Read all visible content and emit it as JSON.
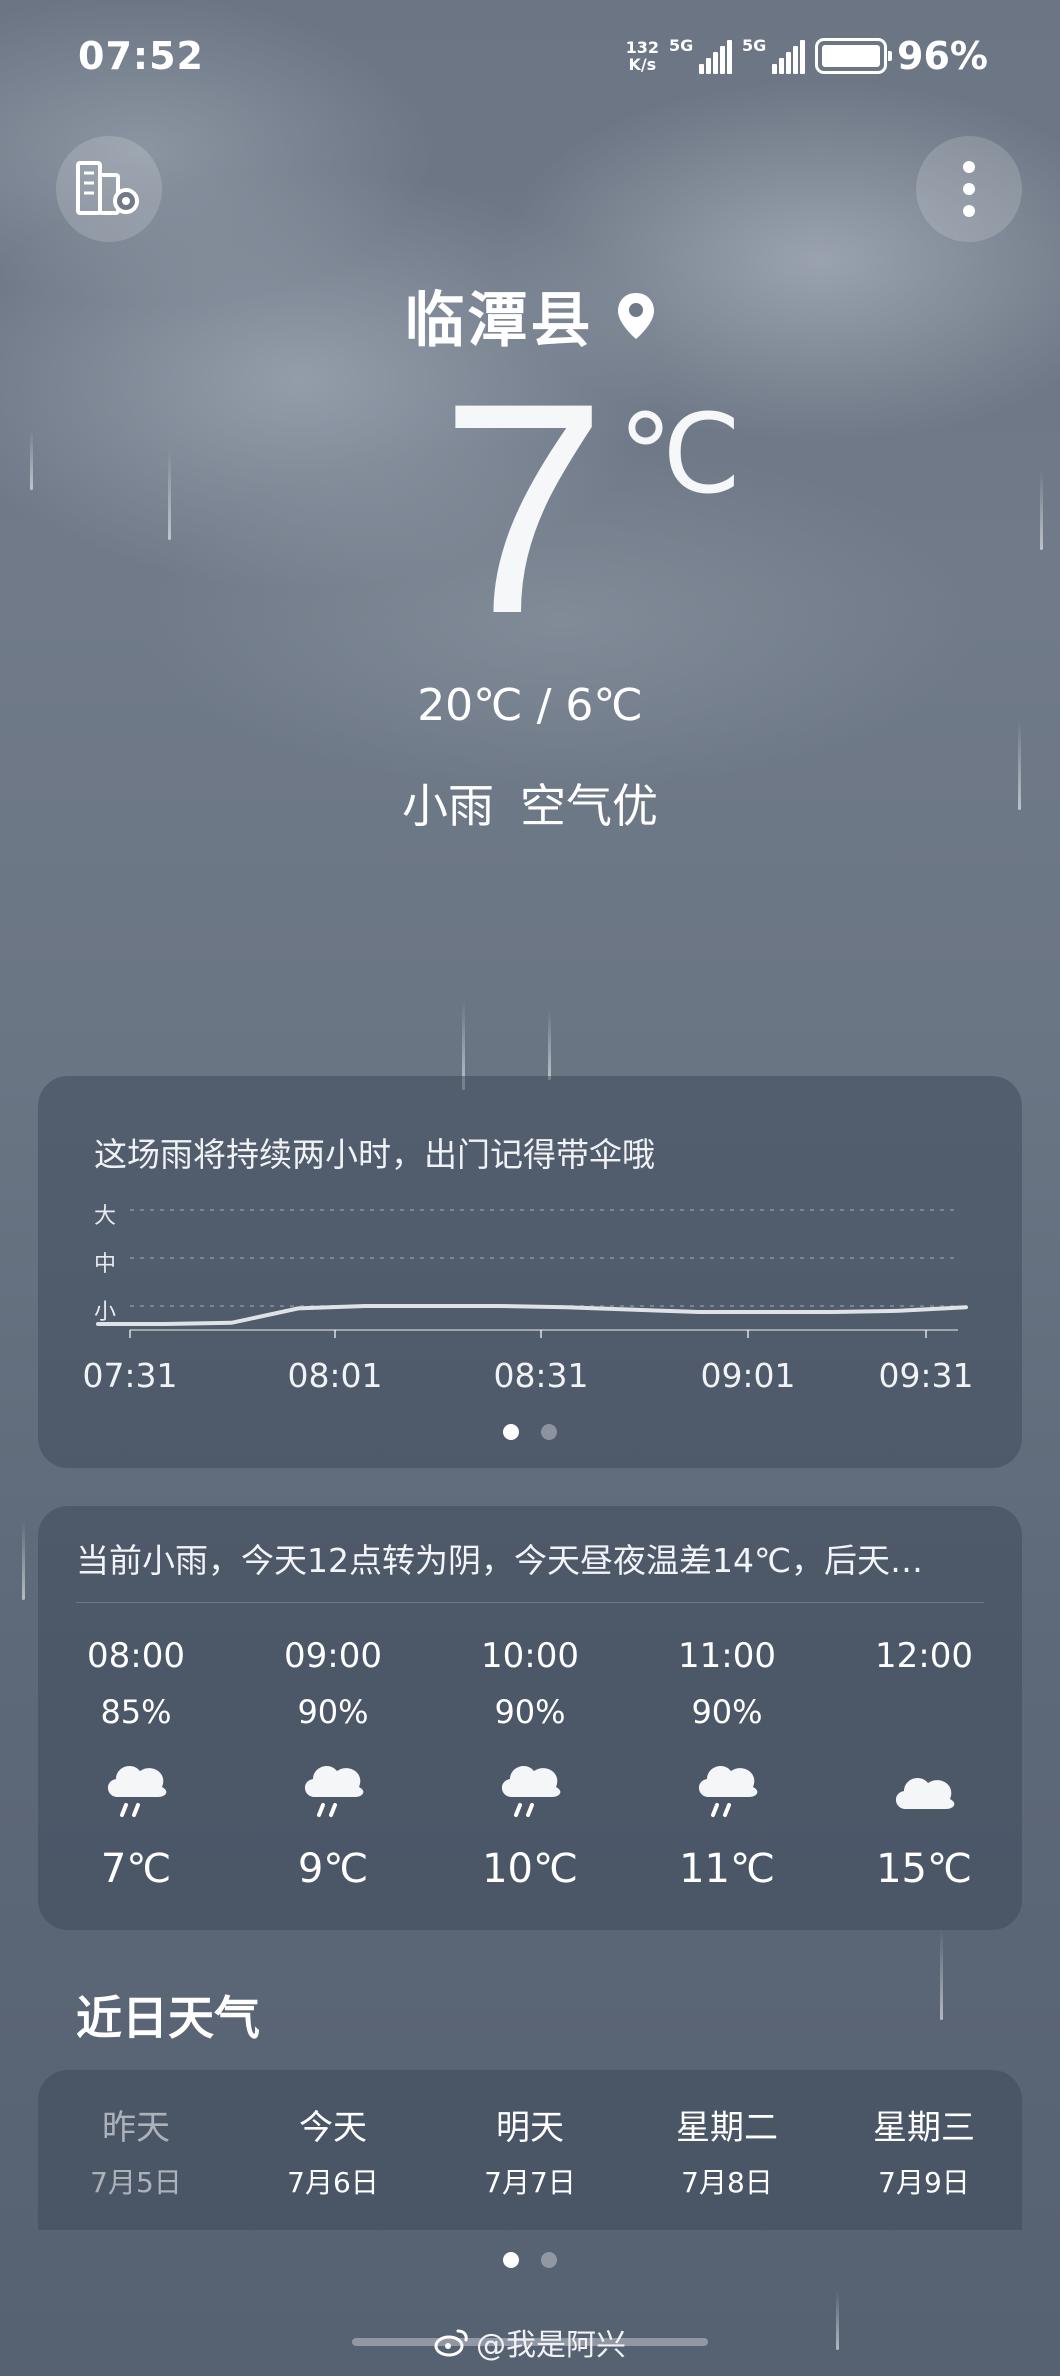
{
  "status_bar": {
    "time": "07:52",
    "net_speed_value": "132",
    "net_speed_unit": "K/s",
    "sim1_label": "5G",
    "sim2_label": "5G",
    "battery_percent": "96%"
  },
  "location": {
    "city": "临潭县"
  },
  "current": {
    "temperature": "7",
    "unit": "℃",
    "range": "20℃ / 6℃",
    "condition": "小雨",
    "air_quality": "空气优"
  },
  "rain_card": {
    "message": "这场雨将持续两小时，出门记得带伞哦",
    "levels": [
      "大",
      "中",
      "小"
    ],
    "times": [
      "07:31",
      "08:01",
      "08:31",
      "09:01",
      "09:31"
    ],
    "intensity": [
      0.05,
      0.05,
      0.06,
      0.18,
      0.2,
      0.2,
      0.2,
      0.19,
      0.17,
      0.15,
      0.15,
      0.15,
      0.16,
      0.19
    ]
  },
  "hourly_card": {
    "summary": "当前小雨，今天12点转为阴，今天昼夜温差14℃，后天…",
    "hours": [
      {
        "time": "08:00",
        "precip": "85%",
        "icon": "light-rain-icon",
        "temp": "7℃"
      },
      {
        "time": "09:00",
        "precip": "90%",
        "icon": "light-rain-icon",
        "temp": "9℃"
      },
      {
        "time": "10:00",
        "precip": "90%",
        "icon": "light-rain-icon",
        "temp": "10℃"
      },
      {
        "time": "11:00",
        "precip": "90%",
        "icon": "light-rain-icon",
        "temp": "11℃"
      },
      {
        "time": "12:00",
        "precip": "",
        "icon": "cloudy-icon",
        "temp": "15℃"
      }
    ]
  },
  "daily_section": {
    "title": "近日天气",
    "days": [
      {
        "name": "昨天",
        "date": "7月5日"
      },
      {
        "name": "今天",
        "date": "7月6日"
      },
      {
        "name": "明天",
        "date": "7月7日"
      },
      {
        "name": "星期二",
        "date": "7月8日"
      },
      {
        "name": "星期三",
        "date": "7月9日"
      }
    ]
  },
  "footer": {
    "watermark": "@我是阿兴"
  }
}
